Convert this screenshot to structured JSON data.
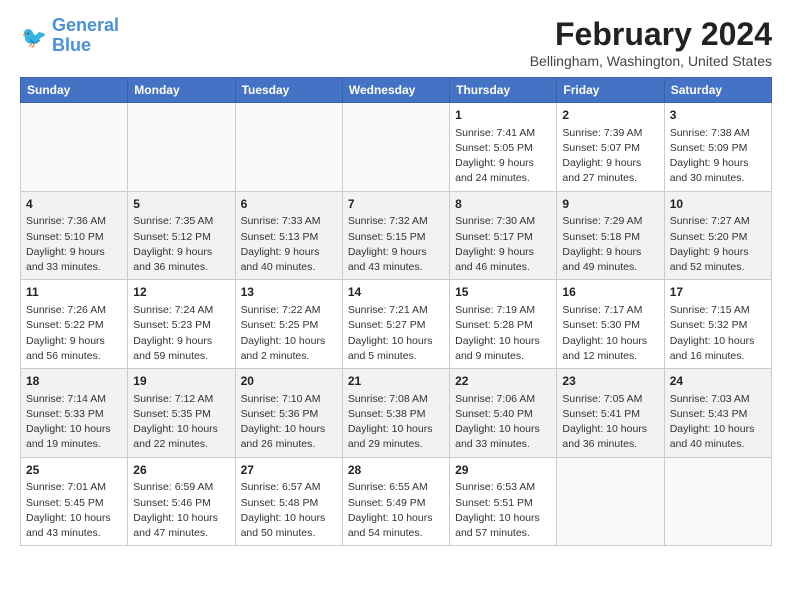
{
  "header": {
    "logo_line1": "General",
    "logo_line2": "Blue",
    "month_year": "February 2024",
    "location": "Bellingham, Washington, United States"
  },
  "days_of_week": [
    "Sunday",
    "Monday",
    "Tuesday",
    "Wednesday",
    "Thursday",
    "Friday",
    "Saturday"
  ],
  "weeks": [
    [
      {
        "day": "",
        "info": ""
      },
      {
        "day": "",
        "info": ""
      },
      {
        "day": "",
        "info": ""
      },
      {
        "day": "",
        "info": ""
      },
      {
        "day": "1",
        "info": "Sunrise: 7:41 AM\nSunset: 5:05 PM\nDaylight: 9 hours\nand 24 minutes."
      },
      {
        "day": "2",
        "info": "Sunrise: 7:39 AM\nSunset: 5:07 PM\nDaylight: 9 hours\nand 27 minutes."
      },
      {
        "day": "3",
        "info": "Sunrise: 7:38 AM\nSunset: 5:09 PM\nDaylight: 9 hours\nand 30 minutes."
      }
    ],
    [
      {
        "day": "4",
        "info": "Sunrise: 7:36 AM\nSunset: 5:10 PM\nDaylight: 9 hours\nand 33 minutes."
      },
      {
        "day": "5",
        "info": "Sunrise: 7:35 AM\nSunset: 5:12 PM\nDaylight: 9 hours\nand 36 minutes."
      },
      {
        "day": "6",
        "info": "Sunrise: 7:33 AM\nSunset: 5:13 PM\nDaylight: 9 hours\nand 40 minutes."
      },
      {
        "day": "7",
        "info": "Sunrise: 7:32 AM\nSunset: 5:15 PM\nDaylight: 9 hours\nand 43 minutes."
      },
      {
        "day": "8",
        "info": "Sunrise: 7:30 AM\nSunset: 5:17 PM\nDaylight: 9 hours\nand 46 minutes."
      },
      {
        "day": "9",
        "info": "Sunrise: 7:29 AM\nSunset: 5:18 PM\nDaylight: 9 hours\nand 49 minutes."
      },
      {
        "day": "10",
        "info": "Sunrise: 7:27 AM\nSunset: 5:20 PM\nDaylight: 9 hours\nand 52 minutes."
      }
    ],
    [
      {
        "day": "11",
        "info": "Sunrise: 7:26 AM\nSunset: 5:22 PM\nDaylight: 9 hours\nand 56 minutes."
      },
      {
        "day": "12",
        "info": "Sunrise: 7:24 AM\nSunset: 5:23 PM\nDaylight: 9 hours\nand 59 minutes."
      },
      {
        "day": "13",
        "info": "Sunrise: 7:22 AM\nSunset: 5:25 PM\nDaylight: 10 hours\nand 2 minutes."
      },
      {
        "day": "14",
        "info": "Sunrise: 7:21 AM\nSunset: 5:27 PM\nDaylight: 10 hours\nand 5 minutes."
      },
      {
        "day": "15",
        "info": "Sunrise: 7:19 AM\nSunset: 5:28 PM\nDaylight: 10 hours\nand 9 minutes."
      },
      {
        "day": "16",
        "info": "Sunrise: 7:17 AM\nSunset: 5:30 PM\nDaylight: 10 hours\nand 12 minutes."
      },
      {
        "day": "17",
        "info": "Sunrise: 7:15 AM\nSunset: 5:32 PM\nDaylight: 10 hours\nand 16 minutes."
      }
    ],
    [
      {
        "day": "18",
        "info": "Sunrise: 7:14 AM\nSunset: 5:33 PM\nDaylight: 10 hours\nand 19 minutes."
      },
      {
        "day": "19",
        "info": "Sunrise: 7:12 AM\nSunset: 5:35 PM\nDaylight: 10 hours\nand 22 minutes."
      },
      {
        "day": "20",
        "info": "Sunrise: 7:10 AM\nSunset: 5:36 PM\nDaylight: 10 hours\nand 26 minutes."
      },
      {
        "day": "21",
        "info": "Sunrise: 7:08 AM\nSunset: 5:38 PM\nDaylight: 10 hours\nand 29 minutes."
      },
      {
        "day": "22",
        "info": "Sunrise: 7:06 AM\nSunset: 5:40 PM\nDaylight: 10 hours\nand 33 minutes."
      },
      {
        "day": "23",
        "info": "Sunrise: 7:05 AM\nSunset: 5:41 PM\nDaylight: 10 hours\nand 36 minutes."
      },
      {
        "day": "24",
        "info": "Sunrise: 7:03 AM\nSunset: 5:43 PM\nDaylight: 10 hours\nand 40 minutes."
      }
    ],
    [
      {
        "day": "25",
        "info": "Sunrise: 7:01 AM\nSunset: 5:45 PM\nDaylight: 10 hours\nand 43 minutes."
      },
      {
        "day": "26",
        "info": "Sunrise: 6:59 AM\nSunset: 5:46 PM\nDaylight: 10 hours\nand 47 minutes."
      },
      {
        "day": "27",
        "info": "Sunrise: 6:57 AM\nSunset: 5:48 PM\nDaylight: 10 hours\nand 50 minutes."
      },
      {
        "day": "28",
        "info": "Sunrise: 6:55 AM\nSunset: 5:49 PM\nDaylight: 10 hours\nand 54 minutes."
      },
      {
        "day": "29",
        "info": "Sunrise: 6:53 AM\nSunset: 5:51 PM\nDaylight: 10 hours\nand 57 minutes."
      },
      {
        "day": "",
        "info": ""
      },
      {
        "day": "",
        "info": ""
      }
    ]
  ]
}
